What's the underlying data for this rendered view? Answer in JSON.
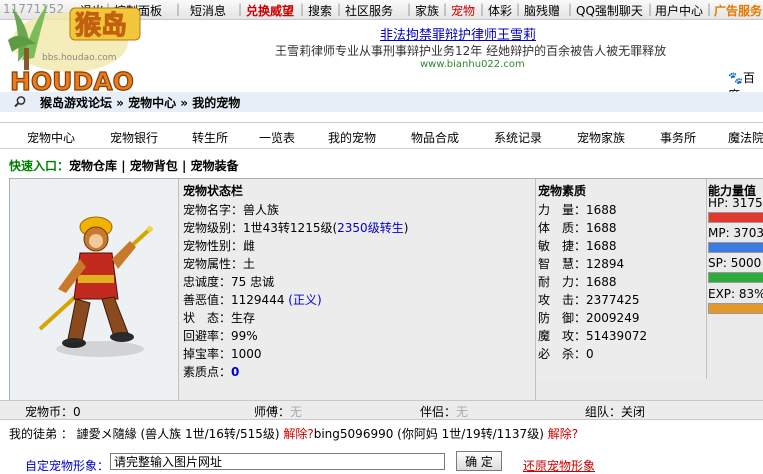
{
  "topbar": {
    "user_id": "11771152",
    "items": [
      "退出",
      "控制面板",
      "短消息",
      "兑换威望",
      "搜索",
      "社区服务",
      "家族",
      "宠物",
      "体彩",
      "脑残赠",
      "QQ强制聊天",
      "用户中心",
      "广告服务"
    ]
  },
  "logo": {
    "text": "HOUDAO",
    "cn": "猴岛",
    "url": "bbs.houdao.com"
  },
  "banner": {
    "title": "非法拘禁罪辩护律师王雪莉",
    "subtitle": "王雪莉律师专业从事刑事辩护业务12年  经她辩护的百余被告人被无罪释放",
    "url": "www.bianhu022.com",
    "baidu": "百度"
  },
  "breadcrumb": {
    "text": "猴岛游戏论坛 » 宠物中心 » 我的宠物"
  },
  "menu": [
    "宠物中心",
    "宠物银行",
    "转生所",
    "一览表",
    "我的宠物",
    "物品合成",
    "系统记录",
    "宠物家族",
    "事务所",
    "魔法院"
  ],
  "quick": {
    "label": "快速入口：",
    "links": [
      "宠物仓库",
      "宠物背包",
      "宠物装备"
    ]
  },
  "status": {
    "header": "宠物状态栏",
    "name_label": "宠物名字：",
    "name": "兽人族",
    "level_label": "宠物级别：",
    "level": "1世43转1215级(",
    "level_link": "2350级转生",
    "level_close": ")",
    "gender_label": "宠物性别：",
    "gender": "雌",
    "element_label": "宠物属性：",
    "element": "土",
    "loyalty_label": "忠诚度：",
    "loyalty": "75 忠诚",
    "karma_label": "善恶值：",
    "karma": "1129444 ",
    "karma_link": "(正义)",
    "state_label": "状　态：",
    "state": "生存",
    "dodge_label": "回避率：",
    "dodge": "99%",
    "drop_label": "掉宝率：",
    "drop": "1000",
    "points_label": "素质点：",
    "points": "0"
  },
  "attributes": {
    "header": "宠物素质",
    "rows": [
      {
        "label": "力　量：",
        "value": "1688"
      },
      {
        "label": "体　质：",
        "value": "1688"
      },
      {
        "label": "敏　捷：",
        "value": "1688"
      },
      {
        "label": "智　慧：",
        "value": "12894"
      },
      {
        "label": "耐　力：",
        "value": "1688"
      },
      {
        "label": "攻　击：",
        "value": "2377425"
      },
      {
        "label": "防　御：",
        "value": "2009249"
      },
      {
        "label": "魔　攻：",
        "value": "51439072"
      },
      {
        "label": "必　杀：",
        "value": "0"
      }
    ]
  },
  "energy": {
    "header": "能力量值",
    "hp": "HP: 3175",
    "mp": "MP: 3703",
    "sp": "SP: 5000",
    "exp": "EXP: 83%",
    "hp_fraction": 1.0,
    "mp_fraction": 1.0,
    "sp_fraction": 1.0,
    "exp_fraction": 0.83,
    "hp_color": "#e23b2e",
    "mp_color": "#3b7be2",
    "sp_color": "#2faa3c",
    "exp_color": "#e29a2e"
  },
  "bottom": {
    "coin_label": "宠物币：",
    "coin": "0",
    "master_label": "师傅：",
    "master": "无",
    "partner_label": "伴侣：",
    "partner": "无",
    "group_label": "组队：",
    "group": "关闭"
  },
  "apprentice": {
    "label": "我的徒弟 ：",
    "first": "謰愛メ隨緣 (兽人族 1世/16转/515级) ",
    "first_action": "解除?",
    "second": "bing5096990 (你阿妈 1世/19转/1137级) ",
    "second_action": "解除?"
  },
  "custom": {
    "label": "自定宠物形象：",
    "input_value": "请完整输入图片网址",
    "confirm": "确 定",
    "restore": "还原宠物形象"
  }
}
